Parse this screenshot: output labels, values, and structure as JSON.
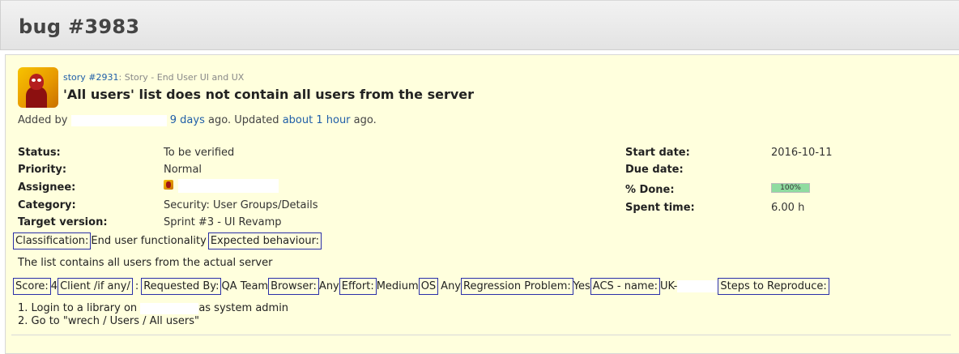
{
  "header": {
    "title": "bug #3983"
  },
  "issue": {
    "parent_link": "story #2931",
    "parent_sep": ": ",
    "parent_desc": "Story - End User UI and UX",
    "subject": "'All users' list does not contain all users from the server",
    "author": {
      "prefix": "Added by",
      "created_link": "9 days",
      "mid": "ago. Updated",
      "updated_link": "about 1 hour",
      "suffix": "ago."
    },
    "attributes_left": [
      {
        "label": "Status:",
        "value": "To be verified"
      },
      {
        "label": "Priority:",
        "value": "Normal"
      },
      {
        "label": "Assignee:",
        "value": ""
      },
      {
        "label": "Category:",
        "value": "Security: User Groups/Details"
      },
      {
        "label": "Target version:",
        "value": "Sprint #3 - UI Revamp"
      }
    ],
    "attributes_right": [
      {
        "label": "Start date:",
        "value": "2016-10-11"
      },
      {
        "label": "Due date:",
        "value": ""
      },
      {
        "label": "% Done:",
        "value": "100%",
        "progress": 1.0
      },
      {
        "label": "Spent time:",
        "value": "6.00 h"
      }
    ],
    "description": {
      "line1": {
        "classification_label": "Classification:",
        "classification_value": "End user functionality",
        "expected_label": "Expected behaviour:"
      },
      "line2": "The list contains all users from the actual server",
      "line3": {
        "score_label": "Score:",
        "score_value": "4",
        "client_label": "Client /if any/",
        "client_sep": ":",
        "requested_label": "Requested By:",
        "requested_value": "QA Team",
        "browser_label": "Browser:",
        "browser_value": "Any",
        "effort_label": "Effort:",
        "effort_value": "Medium",
        "os_label": "OS",
        "os_value": "Any",
        "regression_label": "Regression Problem:",
        "regression_value": "Yes",
        "acs_label": "ACS - name:",
        "acs_value": "UK-",
        "steps_label": "Steps to Reproduce:"
      },
      "steps": [
        {
          "pre": "1. Login to a library on",
          "post": "as system admin"
        },
        {
          "pre": "2. Go to \"wrech / Users / All users\"",
          "post": ""
        }
      ]
    }
  },
  "colors": {
    "issue_bg": "#ffffdd",
    "link": "#1f5ea8",
    "box_border": "#2a2fa8",
    "progress_fill": "#8fdca0"
  }
}
